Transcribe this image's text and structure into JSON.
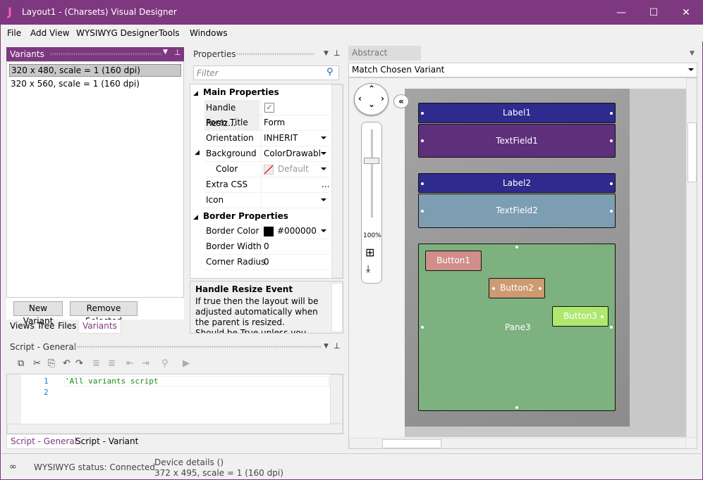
{
  "window": {
    "title": "Layout1 - (Charsets) Visual Designer",
    "logo": "J",
    "minimize": "—",
    "maximize": "☐",
    "close": "✕"
  },
  "menu": [
    "File",
    "Add View",
    "WYSIWYG Designer",
    "Tools",
    "Windows"
  ],
  "variants": {
    "title": "Variants",
    "items": [
      "320 x 480, scale = 1 (160 dpi)",
      "320 x 560, scale = 1 (160 dpi)"
    ],
    "selected": 0,
    "new_button": "New Variant",
    "remove_button": "Remove Selected",
    "tabs": [
      "Views Tree",
      "Files",
      "Variants"
    ],
    "active_tab": 2
  },
  "properties": {
    "title": "Properties",
    "filter_placeholder": "Filter",
    "groups": [
      {
        "label": "Main Properties"
      },
      {
        "label": "Border Properties"
      }
    ],
    "rows": [
      {
        "key": "Handle Resiz...",
        "value": "",
        "checked": true
      },
      {
        "key": "Form Title",
        "value": "Form"
      },
      {
        "key": "Orientation",
        "value": "INHERIT"
      },
      {
        "key": "Background",
        "value": "ColorDrawable"
      },
      {
        "key": "Color",
        "value": "Default"
      },
      {
        "key": "Extra CSS",
        "value": "..."
      },
      {
        "key": "Icon",
        "value": ""
      },
      {
        "key": "Border Color",
        "value": "#000000",
        "swatch": "#000000"
      },
      {
        "key": "Border Width",
        "value": "0"
      },
      {
        "key": "Corner Radius",
        "value": "0"
      }
    ],
    "description": {
      "title": "Handle Resize Event",
      "text": "If true then the layout will be adjusted automatically when the parent is resized.",
      "cut_line": "Should be True unless you change"
    }
  },
  "script": {
    "title": "Script - General",
    "lines": [
      "1",
      "2"
    ],
    "code": "'All variants script",
    "tabs": [
      "Script - General",
      "Script - Variant"
    ],
    "active_tab": 0
  },
  "designer": {
    "tab": "Abstract Designer",
    "variant_select": "Match Chosen Variant",
    "zoom": "100%",
    "widgets": {
      "label1": "Label1",
      "textfield1": "TextField1",
      "label2": "Label2",
      "textfield2": "TextField2",
      "pane3": "Pane3",
      "button1": "Button1",
      "button2": "Button2",
      "button3": "Button3"
    },
    "colors": {
      "label": "#2e2a8e",
      "textfield1": "#5e2f7a",
      "textfield2": "#7d9db2",
      "pane": "#7db17f",
      "button1": "#d08e8a",
      "button2": "#cc9b72",
      "button3": "#aee96e"
    }
  },
  "status": {
    "wysiwyg": "WYSIWYG status: Connected",
    "device_title": "Device details ()",
    "device_info": "372 x 495, scale = 1 (160 dpi)"
  },
  "accent": "#7e3880"
}
